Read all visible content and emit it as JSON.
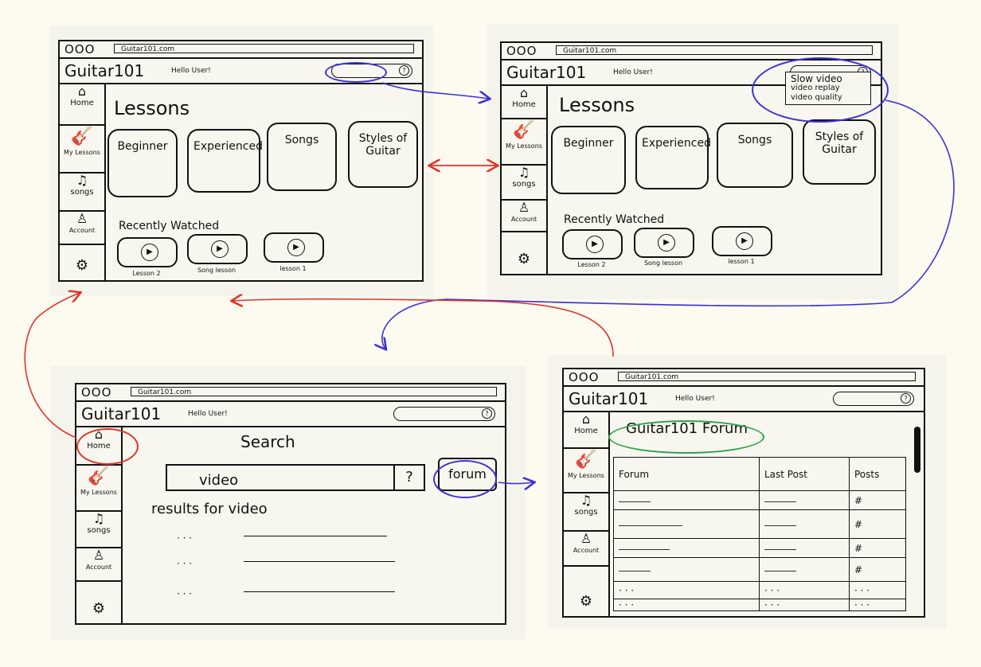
{
  "url": "Guitar101.com",
  "brand": "Guitar101",
  "hello": "Hello User!",
  "help_glyph": "?",
  "window_dots": "OOO",
  "sidebar": {
    "home": "Home",
    "my_lessons": "My Lessons",
    "songs": "songs",
    "account": "Account"
  },
  "lessons_title": "Lessons",
  "cards": [
    "Beginner",
    "Experienced",
    "Songs",
    "Styles of Guitar"
  ],
  "recently_watched": "Recently Watched",
  "recent": [
    "Lesson 2",
    "Song lesson",
    "lesson 1"
  ],
  "help_menu": [
    "Slow video",
    "video replay",
    "video quality"
  ],
  "search": {
    "title": "Search",
    "query": "video",
    "help": "?",
    "forum_button": "forum",
    "results": "results for video",
    "dots": "· · ·"
  },
  "forum": {
    "title": "Guitar101 Forum",
    "headers": [
      "Forum",
      "Last Post",
      "Posts"
    ],
    "posts_marker": "#",
    "dots_short": "· · ·",
    "dots_long": "· ·  ·"
  },
  "colors": {
    "blue_ink": "#3b33d9",
    "red_ink": "#e0342a",
    "green_ink": "#2ea44f"
  }
}
